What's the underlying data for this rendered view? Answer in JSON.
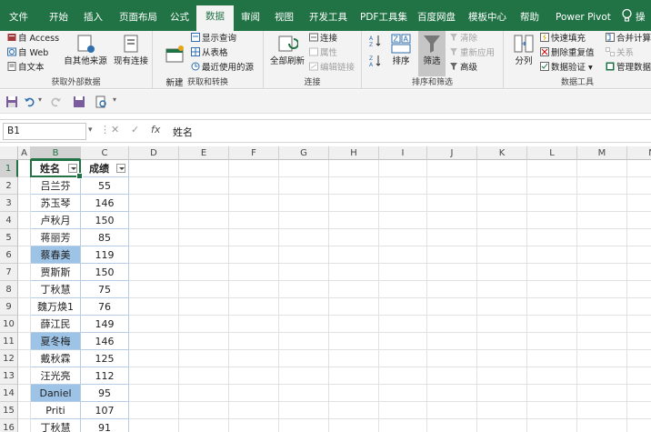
{
  "ribbon_tabs": [
    "文件",
    "开始",
    "插入",
    "页面布局",
    "公式",
    "数据",
    "审阅",
    "视图",
    "开发工具",
    "PDF工具集",
    "百度网盘",
    "模板中心",
    "帮助",
    "Power Pivot"
  ],
  "active_tab": "数据",
  "ribbon": {
    "get_external": {
      "label": "获取外部数据",
      "items": [
        "自 Access",
        "自 Web",
        "自文本"
      ],
      "other_sources": "自其他来源",
      "existing_connections": "现有连接"
    },
    "get_transform": {
      "label": "获取和转换",
      "new_query": "新建\n查询",
      "items": [
        "显示查询",
        "从表格",
        "最近使用的源"
      ]
    },
    "connections": {
      "label": "连接",
      "refresh_all": "全部刷新",
      "items": [
        "连接",
        "属性",
        "编辑链接"
      ]
    },
    "sort_filter": {
      "label": "排序和筛选",
      "sort": "排序",
      "filter": "筛选",
      "items": [
        "清除",
        "重新应用",
        "高级"
      ]
    },
    "data_tools": {
      "label": "数据工具",
      "split": "分列",
      "items": [
        "快速填充",
        "删除重复值",
        "数据验证",
        "合并计算",
        "关系",
        "管理数据模"
      ]
    }
  },
  "namebox": "B1",
  "formula": "姓名",
  "columns": [
    "A",
    "B",
    "C",
    "D",
    "E",
    "F",
    "G",
    "H",
    "I",
    "J",
    "K",
    "L",
    "M",
    "N"
  ],
  "headers": {
    "name": "姓名",
    "score": "成绩"
  },
  "rows": [
    {
      "name": "吕兰芬",
      "score": "55",
      "hl": false
    },
    {
      "name": "苏玉琴",
      "score": "146",
      "hl": false
    },
    {
      "name": "卢秋月",
      "score": "150",
      "hl": false
    },
    {
      "name": "蒋丽芳",
      "score": "85",
      "hl": false
    },
    {
      "name": "蔡春美",
      "score": "119",
      "hl": true
    },
    {
      "name": "贾斯斯",
      "score": "150",
      "hl": false
    },
    {
      "name": "丁秋慧",
      "score": "75",
      "hl": false
    },
    {
      "name": "魏万焕1",
      "score": "76",
      "hl": false
    },
    {
      "name": "薛江民",
      "score": "149",
      "hl": false
    },
    {
      "name": "夏冬梅",
      "score": "146",
      "hl": true
    },
    {
      "name": "戴秋霖",
      "score": "125",
      "hl": false
    },
    {
      "name": "汪光亮",
      "score": "112",
      "hl": false
    },
    {
      "name": "Daniel",
      "score": "95",
      "hl": true
    },
    {
      "name": "Priti",
      "score": "107",
      "hl": false
    },
    {
      "name": "丁秋慧",
      "score": "91",
      "hl": false
    }
  ],
  "row_numbers": [
    "1",
    "2",
    "3",
    "4",
    "5",
    "6",
    "7",
    "8",
    "9",
    "10",
    "11",
    "12",
    "13",
    "14",
    "15",
    "16"
  ],
  "colors": {
    "accent": "#217346",
    "highlight": "#9dc3e6"
  }
}
